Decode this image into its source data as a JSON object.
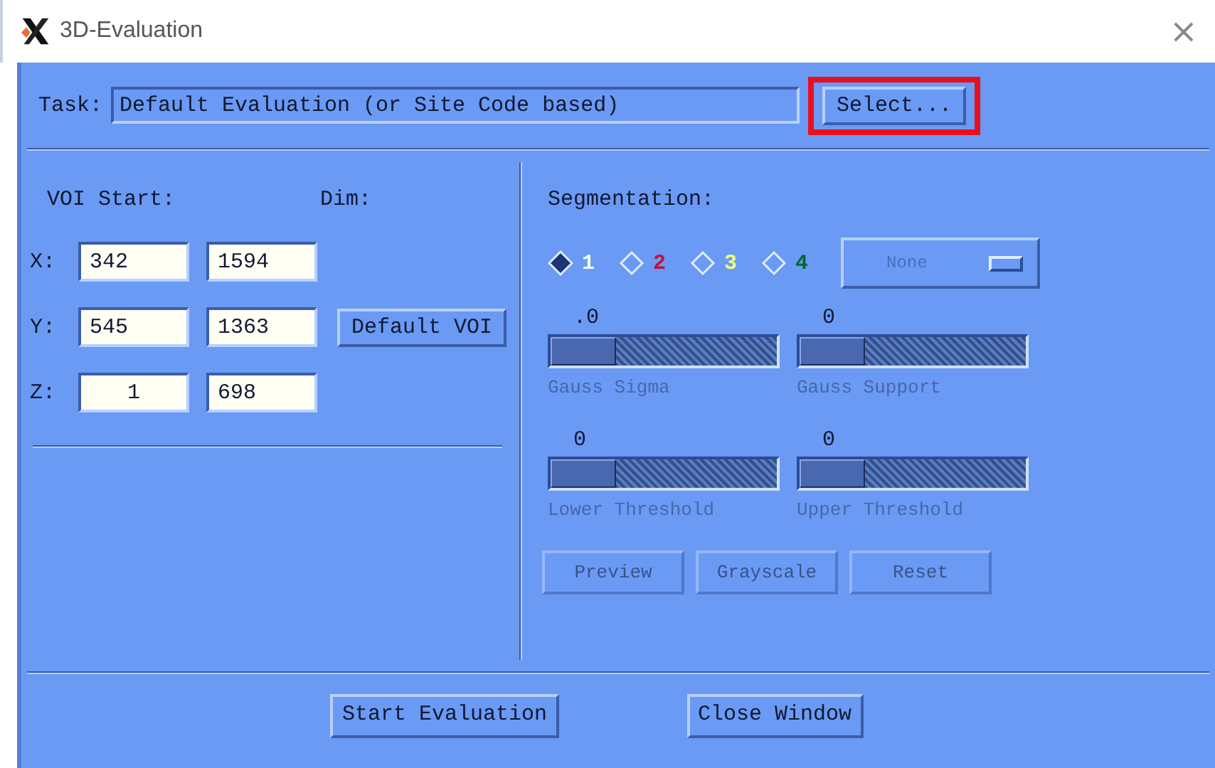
{
  "window": {
    "title": "3D-Evaluation",
    "close": "×"
  },
  "task": {
    "label": "Task:",
    "value": "Default Evaluation (or Site Code based)",
    "button": {
      "label": "Select...",
      "highlighted": true
    }
  },
  "voi": {
    "start_label": "VOI Start:",
    "dim_label": "Dim:",
    "rows": [
      {
        "axis": "X:",
        "start": "342",
        "dim": "1594"
      },
      {
        "axis": "Y:",
        "start": "545",
        "dim": "1363"
      },
      {
        "axis": "Z:",
        "start": "1",
        "dim": "698"
      }
    ],
    "default_button": "Default VOI"
  },
  "segmentation": {
    "label": "Segmentation:",
    "radios": [
      {
        "label": "1",
        "color": "#ffffff",
        "selected": true
      },
      {
        "label": "2",
        "color": "#c0103c",
        "selected": false
      },
      {
        "label": "3",
        "color": "#f0ff80",
        "selected": false
      },
      {
        "label": "4",
        "color": "#006830",
        "selected": false
      }
    ],
    "dropdown": {
      "value": "None",
      "disabled": true
    },
    "sliders": [
      {
        "reading": ".0",
        "label": "Gauss Sigma",
        "level": 0,
        "disabled": true
      },
      {
        "reading": "0",
        "label": "Gauss Support",
        "level": 0,
        "disabled": true
      },
      {
        "reading": "0",
        "label": "Lower Threshold",
        "level": 0,
        "disabled": true
      },
      {
        "reading": "0",
        "label": "Upper Threshold",
        "level": 0,
        "disabled": true
      }
    ],
    "buttons": [
      {
        "label": "Preview",
        "disabled": true
      },
      {
        "label": "Grayscale",
        "disabled": true
      },
      {
        "label": "Reset",
        "disabled": true
      }
    ]
  },
  "buttons": [
    "Start Evaluation",
    "Close Window"
  ]
}
